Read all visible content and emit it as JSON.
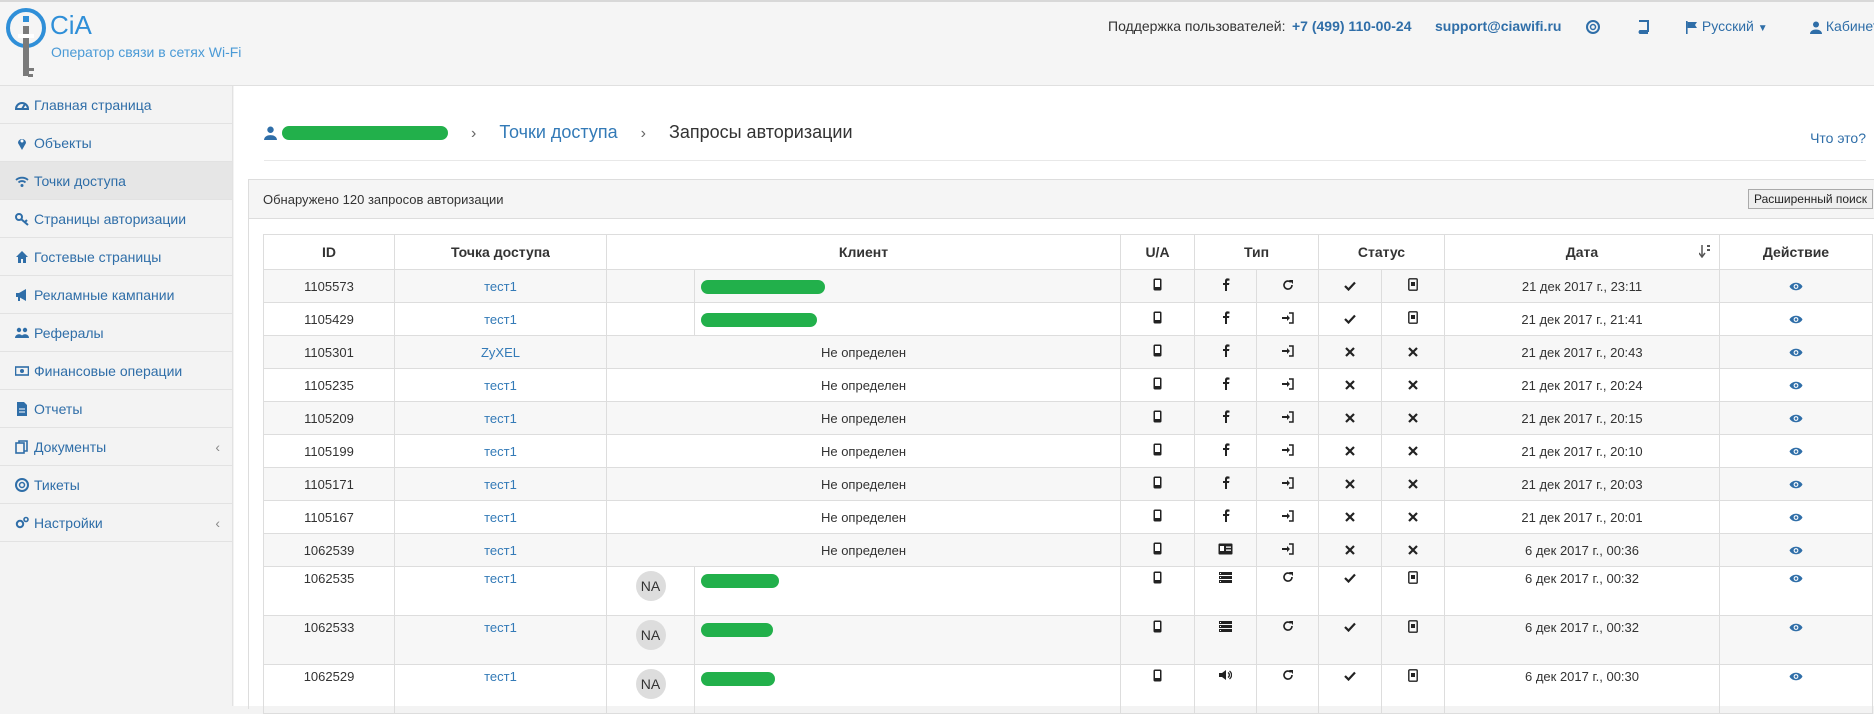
{
  "header": {
    "brand": "CiA",
    "tagline": "Оператор связи в сетях Wi-Fi",
    "support_label": "Поддержка пользователей:",
    "phone": "+7 (499) 110-00-24",
    "email": "support@ciawifi.ru",
    "language": "Русский",
    "cabinet": "Кабинет"
  },
  "sidebar": {
    "items": [
      {
        "label": "Главная страница",
        "icon": "dashboard-icon"
      },
      {
        "label": "Объекты",
        "icon": "map-marker-icon"
      },
      {
        "label": "Точки доступа",
        "icon": "wifi-icon"
      },
      {
        "label": "Страницы авторизации",
        "icon": "key-icon"
      },
      {
        "label": "Гостевые страницы",
        "icon": "home-icon"
      },
      {
        "label": "Рекламные кампании",
        "icon": "bullhorn-icon"
      },
      {
        "label": "Рефералы",
        "icon": "users-icon"
      },
      {
        "label": "Финансовые операции",
        "icon": "money-icon"
      },
      {
        "label": "Отчеты",
        "icon": "file-icon"
      },
      {
        "label": "Документы",
        "icon": "copy-icon"
      },
      {
        "label": "Тикеты",
        "icon": "lifebuoy-icon"
      },
      {
        "label": "Настройки",
        "icon": "cogs-icon"
      }
    ]
  },
  "breadcrumb": {
    "access_points": "Точки доступа",
    "current": "Запросы авторизации"
  },
  "whatis": "Что это?",
  "panel": {
    "found_text": "Обнаружено 120 запросов авторизации",
    "advanced_search": "Расширенный поиск"
  },
  "table": {
    "headers": {
      "id": "ID",
      "ap": "Точка доступа",
      "client": "Клиент",
      "ua": "U/A",
      "type": "Тип",
      "status": "Статус",
      "date": "Дата",
      "action": "Действие"
    },
    "undefined_text": "Не определен",
    "avatar_text": "NA",
    "rows": [
      {
        "id": "1105573",
        "ap": "тест1",
        "client": "redacted",
        "t1": "facebook",
        "t2": "refresh",
        "s1": "check",
        "s2": "phone",
        "date": "21 дек 2017 г., 23:11"
      },
      {
        "id": "1105429",
        "ap": "тест1",
        "client": "redacted",
        "t1": "facebook",
        "t2": "signin",
        "s1": "check",
        "s2": "phone",
        "date": "21 дек 2017 г., 21:41"
      },
      {
        "id": "1105301",
        "ap": "ZyXEL",
        "client": "undefined",
        "t1": "facebook",
        "t2": "signin",
        "s1": "times",
        "s2": "times",
        "date": "21 дек 2017 г., 20:43"
      },
      {
        "id": "1105235",
        "ap": "тест1",
        "client": "undefined",
        "t1": "facebook",
        "t2": "signin",
        "s1": "times",
        "s2": "times",
        "date": "21 дек 2017 г., 20:24"
      },
      {
        "id": "1105209",
        "ap": "тест1",
        "client": "undefined",
        "t1": "facebook",
        "t2": "signin",
        "s1": "times",
        "s2": "times",
        "date": "21 дек 2017 г., 20:15"
      },
      {
        "id": "1105199",
        "ap": "тест1",
        "client": "undefined",
        "t1": "facebook",
        "t2": "signin",
        "s1": "times",
        "s2": "times",
        "date": "21 дек 2017 г., 20:10"
      },
      {
        "id": "1105171",
        "ap": "тест1",
        "client": "undefined",
        "t1": "facebook",
        "t2": "signin",
        "s1": "times",
        "s2": "times",
        "date": "21 дек 2017 г., 20:03"
      },
      {
        "id": "1105167",
        "ap": "тест1",
        "client": "undefined",
        "t1": "facebook",
        "t2": "signin",
        "s1": "times",
        "s2": "times",
        "date": "21 дек 2017 г., 20:01"
      },
      {
        "id": "1062539",
        "ap": "тест1",
        "client": "undefined",
        "t1": "idcard",
        "t2": "signin",
        "s1": "times",
        "s2": "times",
        "date": "6 дек 2017 г., 00:36"
      },
      {
        "id": "1062535",
        "ap": "тест1",
        "client": "avatar",
        "t1": "list",
        "t2": "refresh",
        "s1": "check",
        "s2": "phone",
        "date": "6 дек 2017 г., 00:32"
      },
      {
        "id": "1062533",
        "ap": "тест1",
        "client": "avatar",
        "t1": "list",
        "t2": "refresh",
        "s1": "check",
        "s2": "phone",
        "date": "6 дек 2017 г., 00:32"
      },
      {
        "id": "1062529",
        "ap": "тест1",
        "client": "avatar",
        "t1": "volume",
        "t2": "refresh",
        "s1": "check",
        "s2": "phone",
        "date": "6 дек 2017 г., 00:30"
      }
    ]
  }
}
